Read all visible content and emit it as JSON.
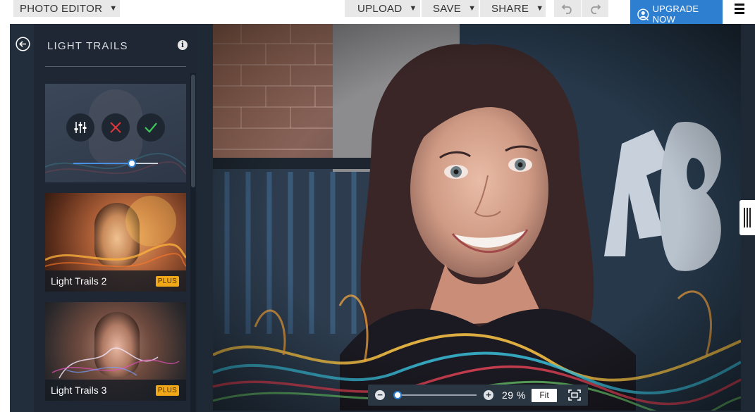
{
  "topbar": {
    "editor_menu_label": "PHOTO EDITOR",
    "upload_label": "UPLOAD",
    "save_label": "SAVE",
    "share_label": "SHARE",
    "upgrade_label": "UPGRADE NOW",
    "icons": [
      "chevron-down-icon",
      "undo-icon",
      "redo-icon",
      "upgrade-user-icon",
      "menu-icon"
    ]
  },
  "panel": {
    "title": "LIGHT TRAILS",
    "icons": [
      "back-icon",
      "info-icon",
      "adjust-icon",
      "cancel-icon",
      "apply-icon"
    ],
    "active_intensity": 0.7,
    "filters": [
      {
        "name": "Light Trails 2",
        "badge": "PLUS"
      },
      {
        "name": "Light Trails 3",
        "badge": "PLUS"
      }
    ]
  },
  "zoom": {
    "value": "29 %",
    "fit_label": "Fit",
    "icons": [
      "zoom-out-icon",
      "zoom-in-icon",
      "fullscreen-icon"
    ]
  },
  "colors": {
    "accent": "#2f7fd1",
    "panel_bg": "#1e2733",
    "plus_badge": "#f0a818",
    "cancel": "#e0363a",
    "apply": "#3cc85a"
  }
}
